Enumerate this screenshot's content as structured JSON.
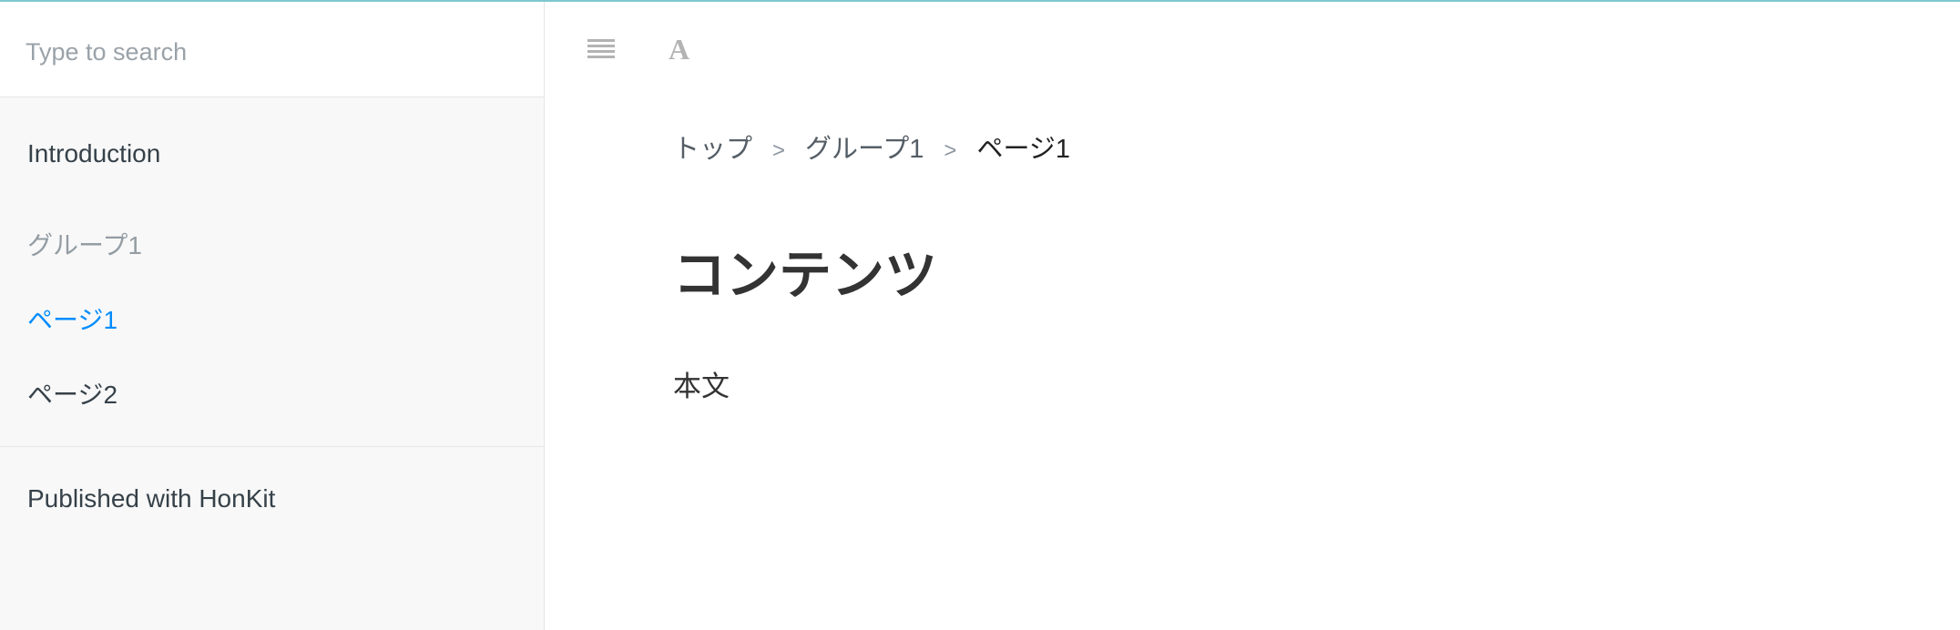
{
  "search": {
    "placeholder": "Type to search"
  },
  "sidebar": {
    "items": [
      {
        "label": "Introduction"
      },
      {
        "label": "グループ1"
      },
      {
        "label": "ページ1"
      },
      {
        "label": "ページ2"
      }
    ],
    "footer": "Published with HonKit"
  },
  "toolbar": {
    "menu_icon": "hamburger-icon",
    "font_icon_glyph": "A"
  },
  "breadcrumb": {
    "items": [
      "トップ",
      "グループ1",
      "ページ1"
    ],
    "separator": ">"
  },
  "content": {
    "title": "コンテンツ",
    "body": "本文"
  },
  "colors": {
    "accent_line": "#7ec8cf",
    "active_link": "#008cff",
    "sidebar_bg": "#f8f8f8"
  }
}
